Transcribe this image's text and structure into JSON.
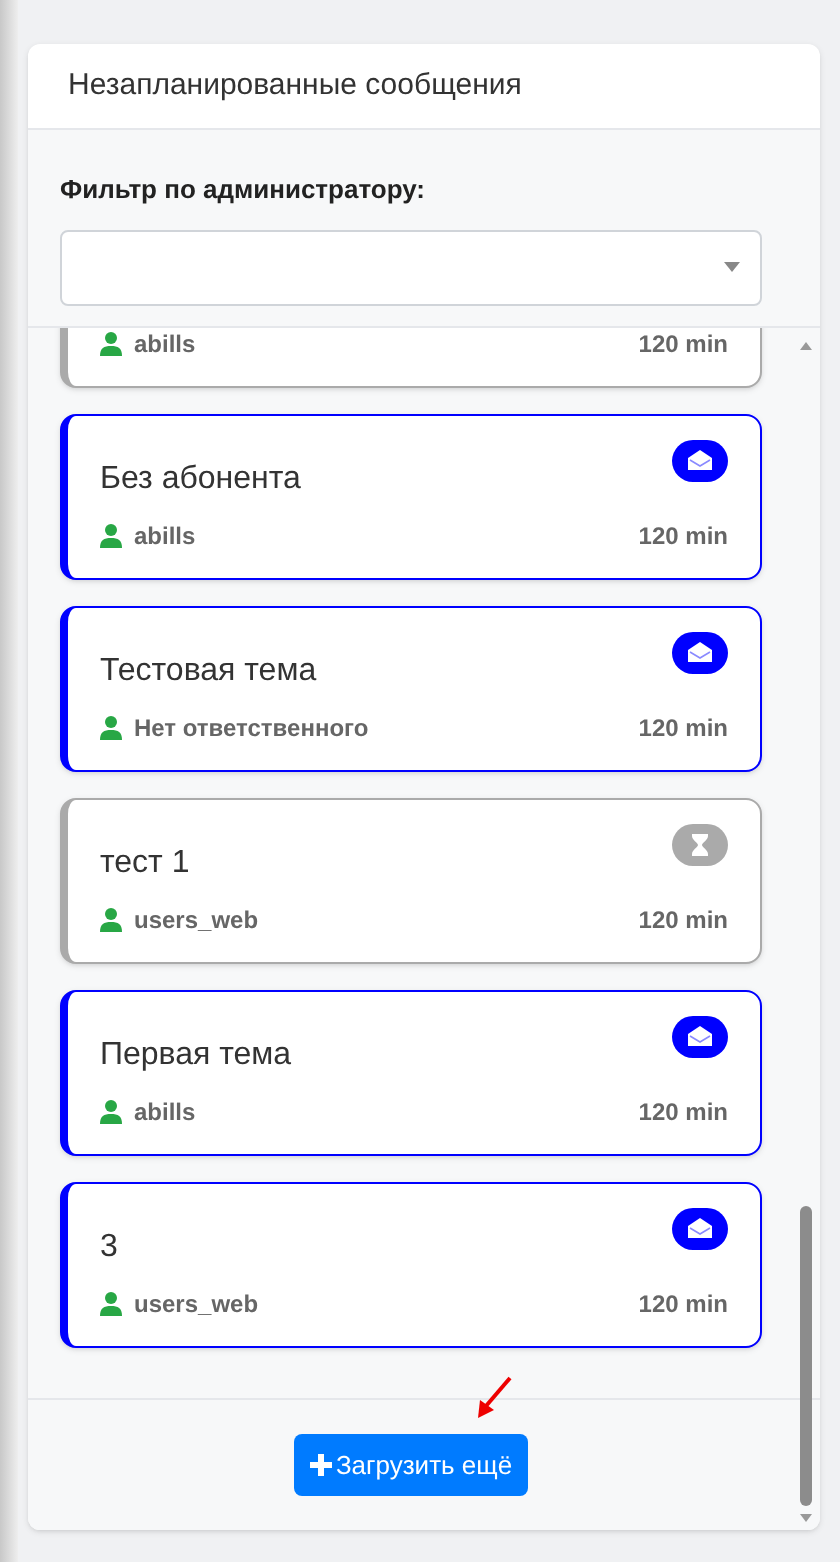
{
  "panel": {
    "title": "Незапланированные сообщения"
  },
  "filter": {
    "label": "Фильтр по администратору:"
  },
  "messages": [
    {
      "kind": "pending",
      "assignee": "abills",
      "duration": "120 min"
    },
    {
      "title": "Без абонента",
      "kind": "new",
      "assignee": "abills",
      "duration": "120 min"
    },
    {
      "title": "Тестовая тема",
      "kind": "new",
      "assignee": "Нет ответственного",
      "duration": "120 min"
    },
    {
      "title": "тест 1",
      "kind": "pending",
      "assignee": "users_web",
      "duration": "120 min"
    },
    {
      "title": "Первая тема",
      "kind": "new",
      "assignee": "abills",
      "duration": "120 min"
    },
    {
      "title": "3",
      "kind": "new",
      "assignee": "users_web",
      "duration": "120 min"
    }
  ],
  "load_more": {
    "label": "Загрузить ещё"
  }
}
